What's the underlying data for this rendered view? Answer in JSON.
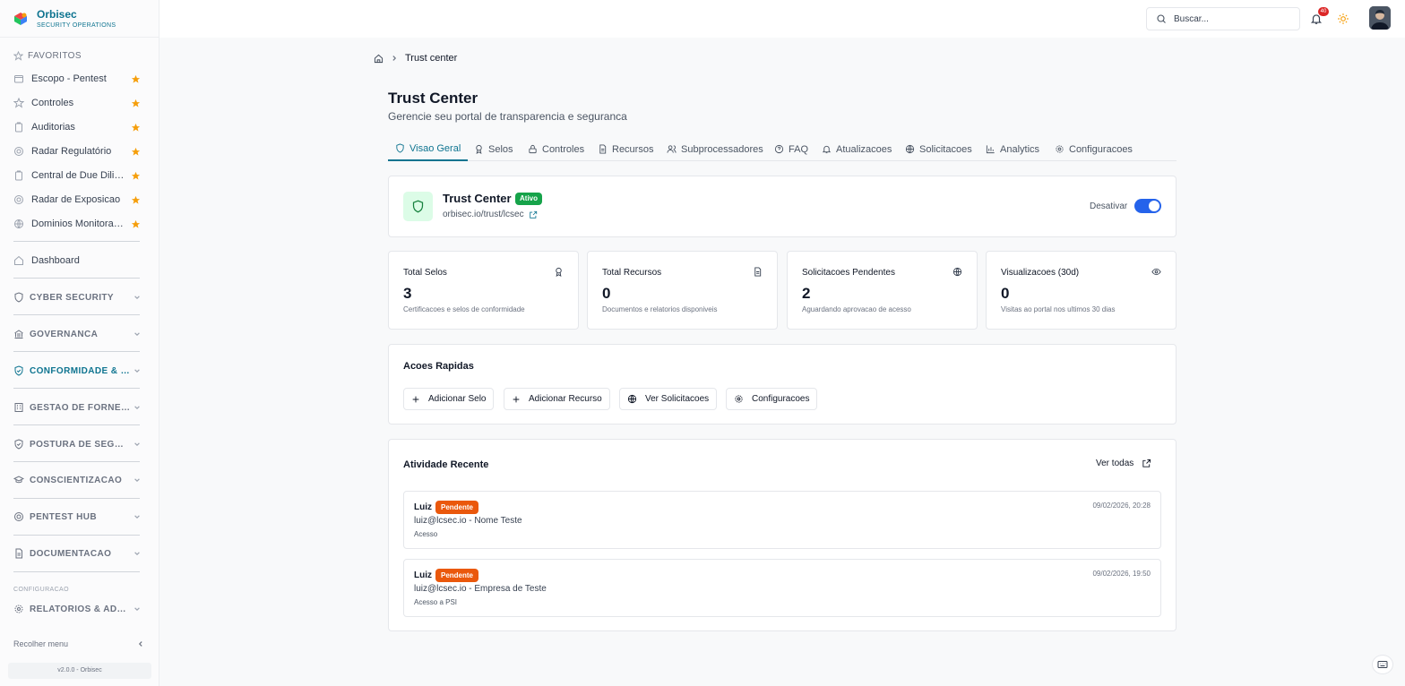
{
  "app": {
    "name": "Orbisec",
    "subtitle": "SECURITY OPERATIONS",
    "version": "v2.0.0 - Orbisec"
  },
  "colors": {
    "accent": "#0e7490",
    "star": "#f59e0b",
    "active_badge": "#16a34a",
    "pending_badge": "#ea580c",
    "toggle": "#2563eb"
  },
  "sidebar": {
    "favorites_title": "FAVORITOS",
    "favorites": [
      {
        "label": "Escopo - Pentest",
        "icon": "folder-icon"
      },
      {
        "label": "Controles",
        "icon": "star-icon"
      },
      {
        "label": "Auditorias",
        "icon": "clipboard-icon"
      },
      {
        "label": "Radar Regulatório",
        "icon": "radar-icon"
      },
      {
        "label": "Central de Due Dilige...",
        "icon": "clipboard-icon"
      },
      {
        "label": "Radar de Exposicao",
        "icon": "radar-icon"
      },
      {
        "label": "Dominios Monitorados",
        "icon": "globe-icon"
      }
    ],
    "dashboard": "Dashboard",
    "groups": [
      {
        "label": "CYBER SECURITY",
        "icon": "shield-icon",
        "active": false
      },
      {
        "label": "GOVERNANCA",
        "icon": "bank-icon",
        "active": false
      },
      {
        "label": "CONFORMIDADE & RIS...",
        "icon": "shield-check-icon",
        "active": true
      },
      {
        "label": "GESTAO DE FORNECE...",
        "icon": "building-icon",
        "active": false
      },
      {
        "label": "POSTURA DE SEGURA...",
        "icon": "shield-check-icon",
        "active": false
      },
      {
        "label": "CONSCIENTIZACAO",
        "icon": "graduation-icon",
        "active": false
      },
      {
        "label": "PENTEST HUB",
        "icon": "target-icon",
        "active": false
      },
      {
        "label": "DOCUMENTACAO",
        "icon": "document-icon",
        "active": false
      }
    ],
    "config_label": "CONFIGURACAO",
    "admin_group": "RELATORIOS & ADMIN",
    "collapse_label": "Recolher menu"
  },
  "topbar": {
    "search_placeholder": "Buscar...",
    "notification_count": "40"
  },
  "breadcrumb": {
    "current": "Trust center"
  },
  "page": {
    "title": "Trust Center",
    "subtitle": "Gerencie seu portal de transparencia e seguranca"
  },
  "tabs": [
    {
      "label": "Visao Geral",
      "icon": "shield-icon",
      "active": true
    },
    {
      "label": "Selos",
      "icon": "award-icon"
    },
    {
      "label": "Controles",
      "icon": "lock-icon"
    },
    {
      "label": "Recursos",
      "icon": "file-icon"
    },
    {
      "label": "Subprocessadores",
      "icon": "users-icon"
    },
    {
      "label": "FAQ",
      "icon": "help-icon"
    },
    {
      "label": "Atualizacoes",
      "icon": "bell-icon"
    },
    {
      "label": "Solicitacoes",
      "icon": "globe-icon"
    },
    {
      "label": "Analytics",
      "icon": "bar-chart-icon"
    },
    {
      "label": "Configuracoes",
      "icon": "gear-icon"
    }
  ],
  "trust_card": {
    "title": "Trust Center",
    "status": "Ativo",
    "url": "orbisec.io/trust/lcsec",
    "toggle_label": "Desativar",
    "enabled": true
  },
  "stats": [
    {
      "label": "Total Selos",
      "value": "3",
      "desc": "Certificacoes e selos de conformidade",
      "icon": "award-icon"
    },
    {
      "label": "Total Recursos",
      "value": "0",
      "desc": "Documentos e relatorios disponiveis",
      "icon": "file-icon"
    },
    {
      "label": "Solicitacoes Pendentes",
      "value": "2",
      "desc": "Aguardando aprovacao de acesso",
      "icon": "globe-icon"
    },
    {
      "label": "Visualizacoes (30d)",
      "value": "0",
      "desc": "Visitas ao portal nos ultimos 30 dias",
      "icon": "eye-icon"
    }
  ],
  "quick_actions": {
    "title": "Acoes Rapidas",
    "buttons": [
      {
        "label": "Adicionar Selo",
        "icon": "plus-icon"
      },
      {
        "label": "Adicionar Recurso",
        "icon": "plus-icon"
      },
      {
        "label": "Ver Solicitacoes",
        "icon": "globe-icon"
      },
      {
        "label": "Configuracoes",
        "icon": "gear-icon"
      }
    ]
  },
  "activity": {
    "title": "Atividade Recente",
    "view_all": "Ver todas",
    "items": [
      {
        "name": "Luiz",
        "status": "Pendente",
        "line": "luiz@lcsec.io - Nome Teste",
        "type": "Acesso",
        "date": "09/02/2026, 20:28"
      },
      {
        "name": "Luiz",
        "status": "Pendente",
        "line": "luiz@lcsec.io - Empresa de Teste",
        "type": "Acesso a PSI",
        "date": "09/02/2026, 19:50"
      }
    ]
  }
}
